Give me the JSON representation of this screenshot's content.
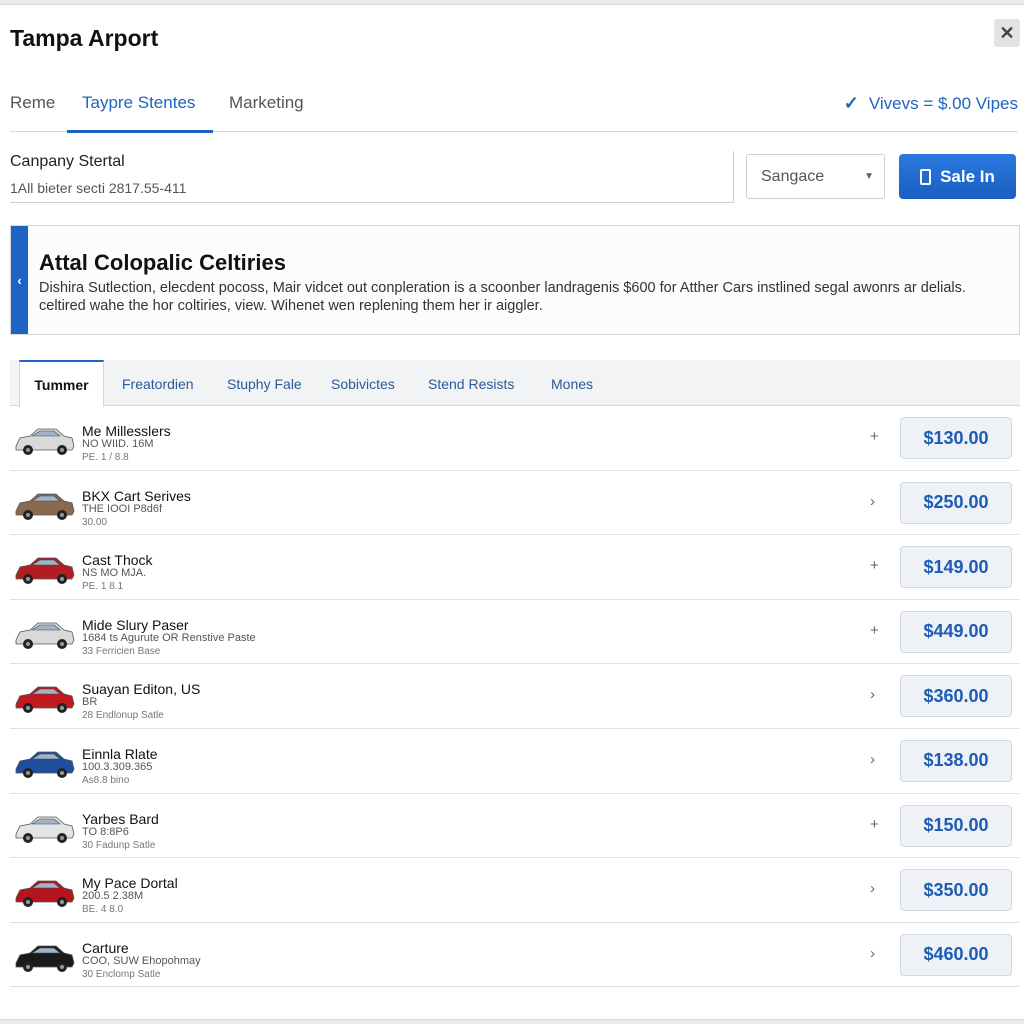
{
  "window": {
    "title": "Tampa Arport",
    "close_icon": "close-icon"
  },
  "top_tabs": [
    {
      "label": "Reme"
    },
    {
      "label": "Taypre Stentes"
    },
    {
      "label": "Marketing"
    }
  ],
  "views_summary": "Vivevs = $.00 Vipes",
  "company": {
    "title": "Canpany Stertal",
    "subtitle": "1All bieter secti 2817.55-411"
  },
  "select": {
    "value": "Sangace"
  },
  "primary_button": {
    "label": "Sale In",
    "icon": "phone-icon"
  },
  "banner": {
    "title": "Attal Colopalic Celtiries",
    "text": "Dishira Sutlection, elecdent pocoss,  Mair vidcet out conpleration is a scoonber landragenis $600 for Atther Cars instlined segal awonrs ar delials. celtired wahe the hor coltiries, view. Wihenet wen replening them her ir aiggler."
  },
  "sub_tabs": [
    {
      "label": "Tummer"
    },
    {
      "label": "Freatordien"
    },
    {
      "label": "Stuphy Fale"
    },
    {
      "label": "Sobivictes"
    },
    {
      "label": "Stend Resists"
    },
    {
      "label": "Mones"
    }
  ],
  "rows": [
    {
      "title": "Me Millesslers",
      "line2": "NO WIID. 16M",
      "line3": "PE. 1 / 8.8",
      "action": "+",
      "price": "$130.00",
      "color": "#d9d9d9"
    },
    {
      "title": "BKX Cart Serives",
      "line2": "THE IOOI P8d6f",
      "line3": "30.00",
      "action": "›",
      "price": "$250.00",
      "color": "#8a6a4e"
    },
    {
      "title": "Cast Thock",
      "line2": "NS MO MJA.",
      "line3": "PE. 1 8.1",
      "action": "+",
      "price": "$149.00",
      "color": "#b01e24"
    },
    {
      "title": "Mide Slury Paser",
      "line2": "1684 ts Agurute OR Renstive Paste",
      "line3": "33 Ferricien Base",
      "action": "+",
      "price": "$449.00",
      "color": "#d9d9d9"
    },
    {
      "title": "Suayan Editon, US",
      "line2": "BR",
      "line3": "28 Endlonup Satle",
      "action": "›",
      "price": "$360.00",
      "color": "#c0191f"
    },
    {
      "title": "Einnla Rlate",
      "line2": "100.3.309.365",
      "line3": "As8.8 bino",
      "action": "›",
      "price": "$138.00",
      "color": "#1d4f9e"
    },
    {
      "title": "Yarbes Bard",
      "line2": "TO 8:8P6",
      "line3": "30 Fadunp Satle",
      "action": "+",
      "price": "$150.00",
      "color": "#e4e4e4"
    },
    {
      "title": "My Pace Dortal",
      "line2": "200.5 2.38M",
      "line3": "BE. 4 8.0",
      "action": "›",
      "price": "$350.00",
      "color": "#b3141d"
    },
    {
      "title": "Carture",
      "line2": "COO, SUW Ehopohmay",
      "line3": "30 Enclomp Satle",
      "action": "›",
      "price": "$460.00",
      "color": "#1a1a1a"
    }
  ]
}
